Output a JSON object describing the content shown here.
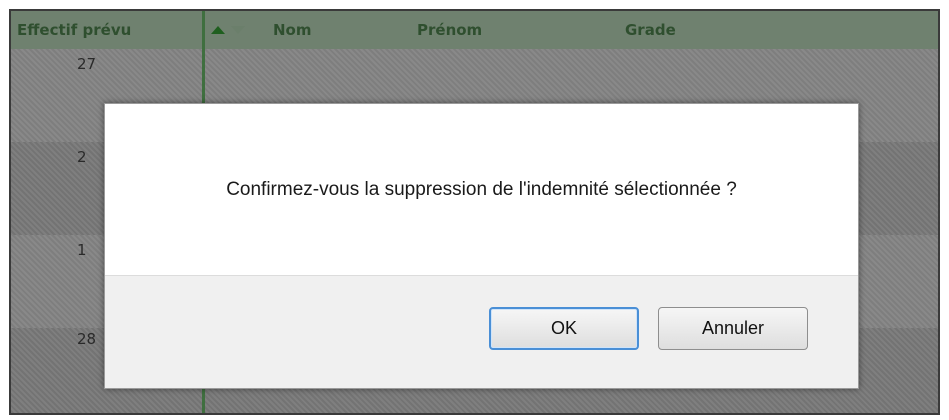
{
  "grid": {
    "columns": {
      "effectif": "Effectif prévu",
      "nom": "Nom",
      "prenom": "Prénom",
      "grade": "Grade"
    },
    "rows": [
      {
        "effectif": "27"
      },
      {
        "effectif": "2"
      },
      {
        "effectif": "1"
      },
      {
        "effectif": "28"
      }
    ],
    "sort_icons": [
      "sort-ascending-icon",
      "sort-descending-icon"
    ]
  },
  "dialog": {
    "message": "Confirmez-vous la suppression de l'indemnité sélectionnée ?",
    "ok_label": "OK",
    "cancel_label": "Annuler"
  },
  "colors": {
    "header_bg": "#6f816f",
    "header_text": "#2f4f2f",
    "overlay_row": "#838383",
    "ok_focus_border": "#4a8fd6"
  }
}
